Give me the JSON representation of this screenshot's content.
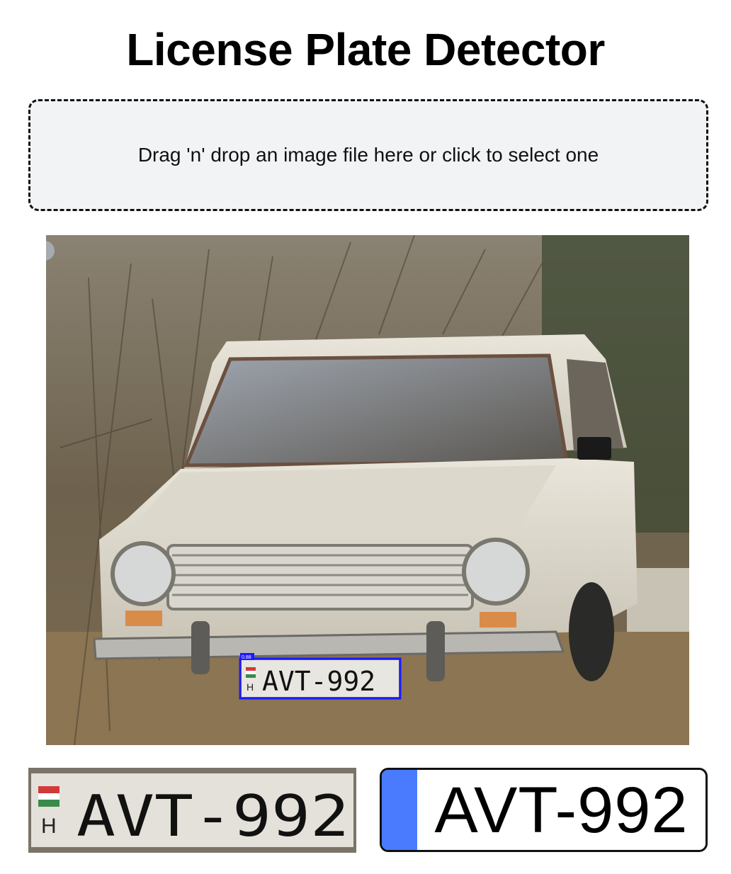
{
  "page": {
    "title": "License Plate Detector"
  },
  "dropzone": {
    "prompt": "Drag 'n' drop an image file here or click to select one"
  },
  "photo": {
    "watermark": "",
    "detection": {
      "confidence_label": "0.88",
      "plate_text": "AVT-992",
      "country_code": "H",
      "box_color": "#1a1aff"
    }
  },
  "result": {
    "plate_text": "AVT-992",
    "crop_country_code": "H",
    "band_color": "#4a7bff"
  }
}
